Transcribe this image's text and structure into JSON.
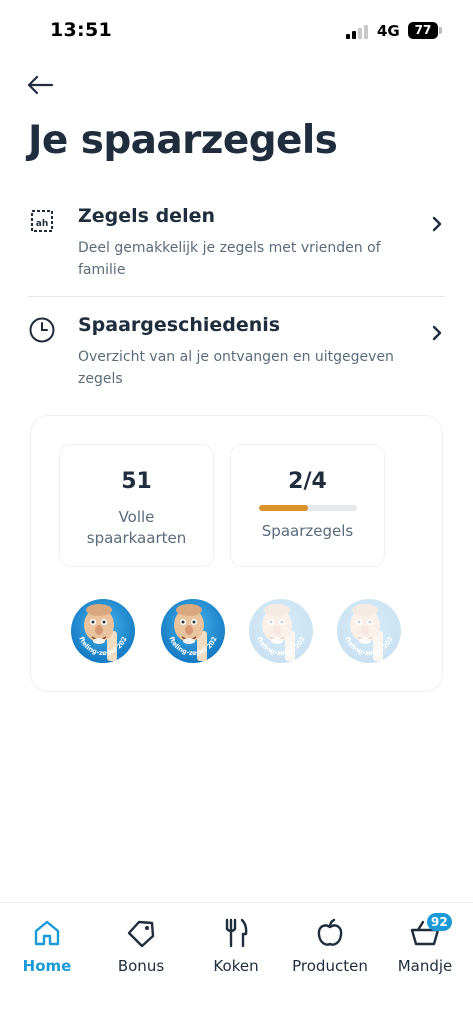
{
  "status_bar": {
    "time": "13:51",
    "network": "4G",
    "battery": "77"
  },
  "page": {
    "title": "Je spaarzegels"
  },
  "menu": [
    {
      "title": "Zegels delen",
      "subtitle": "Deel gemakkelijk je zegels met vrienden of familie",
      "icon": "share-stamps-icon"
    },
    {
      "title": "Spaargeschiedenis",
      "subtitle": "Overzicht van al je ontvangen en uitgegeven zegels",
      "icon": "clock-icon"
    }
  ],
  "summary": {
    "full_cards_value": "51",
    "full_cards_label": "Volle spaarkaarten",
    "stamps_value": "2/4",
    "stamps_label": "Spaarzegels",
    "stamps_progress": 0.5,
    "stamp_collected": [
      true,
      true,
      false,
      false
    ],
    "stamp_text": "Efteling-zegel 2026"
  },
  "colors": {
    "accent": "#1a9bd7",
    "progress": "#d9932a",
    "text": "#1f2d3d"
  },
  "tabs": [
    {
      "label": "Home",
      "icon": "home-icon",
      "active": true
    },
    {
      "label": "Bonus",
      "icon": "bonus-tag-icon",
      "active": false
    },
    {
      "label": "Koken",
      "icon": "cutlery-icon",
      "active": false
    },
    {
      "label": "Producten",
      "icon": "apple-icon",
      "active": false
    },
    {
      "label": "Mandje",
      "icon": "basket-icon",
      "active": false,
      "badge": "92"
    }
  ]
}
